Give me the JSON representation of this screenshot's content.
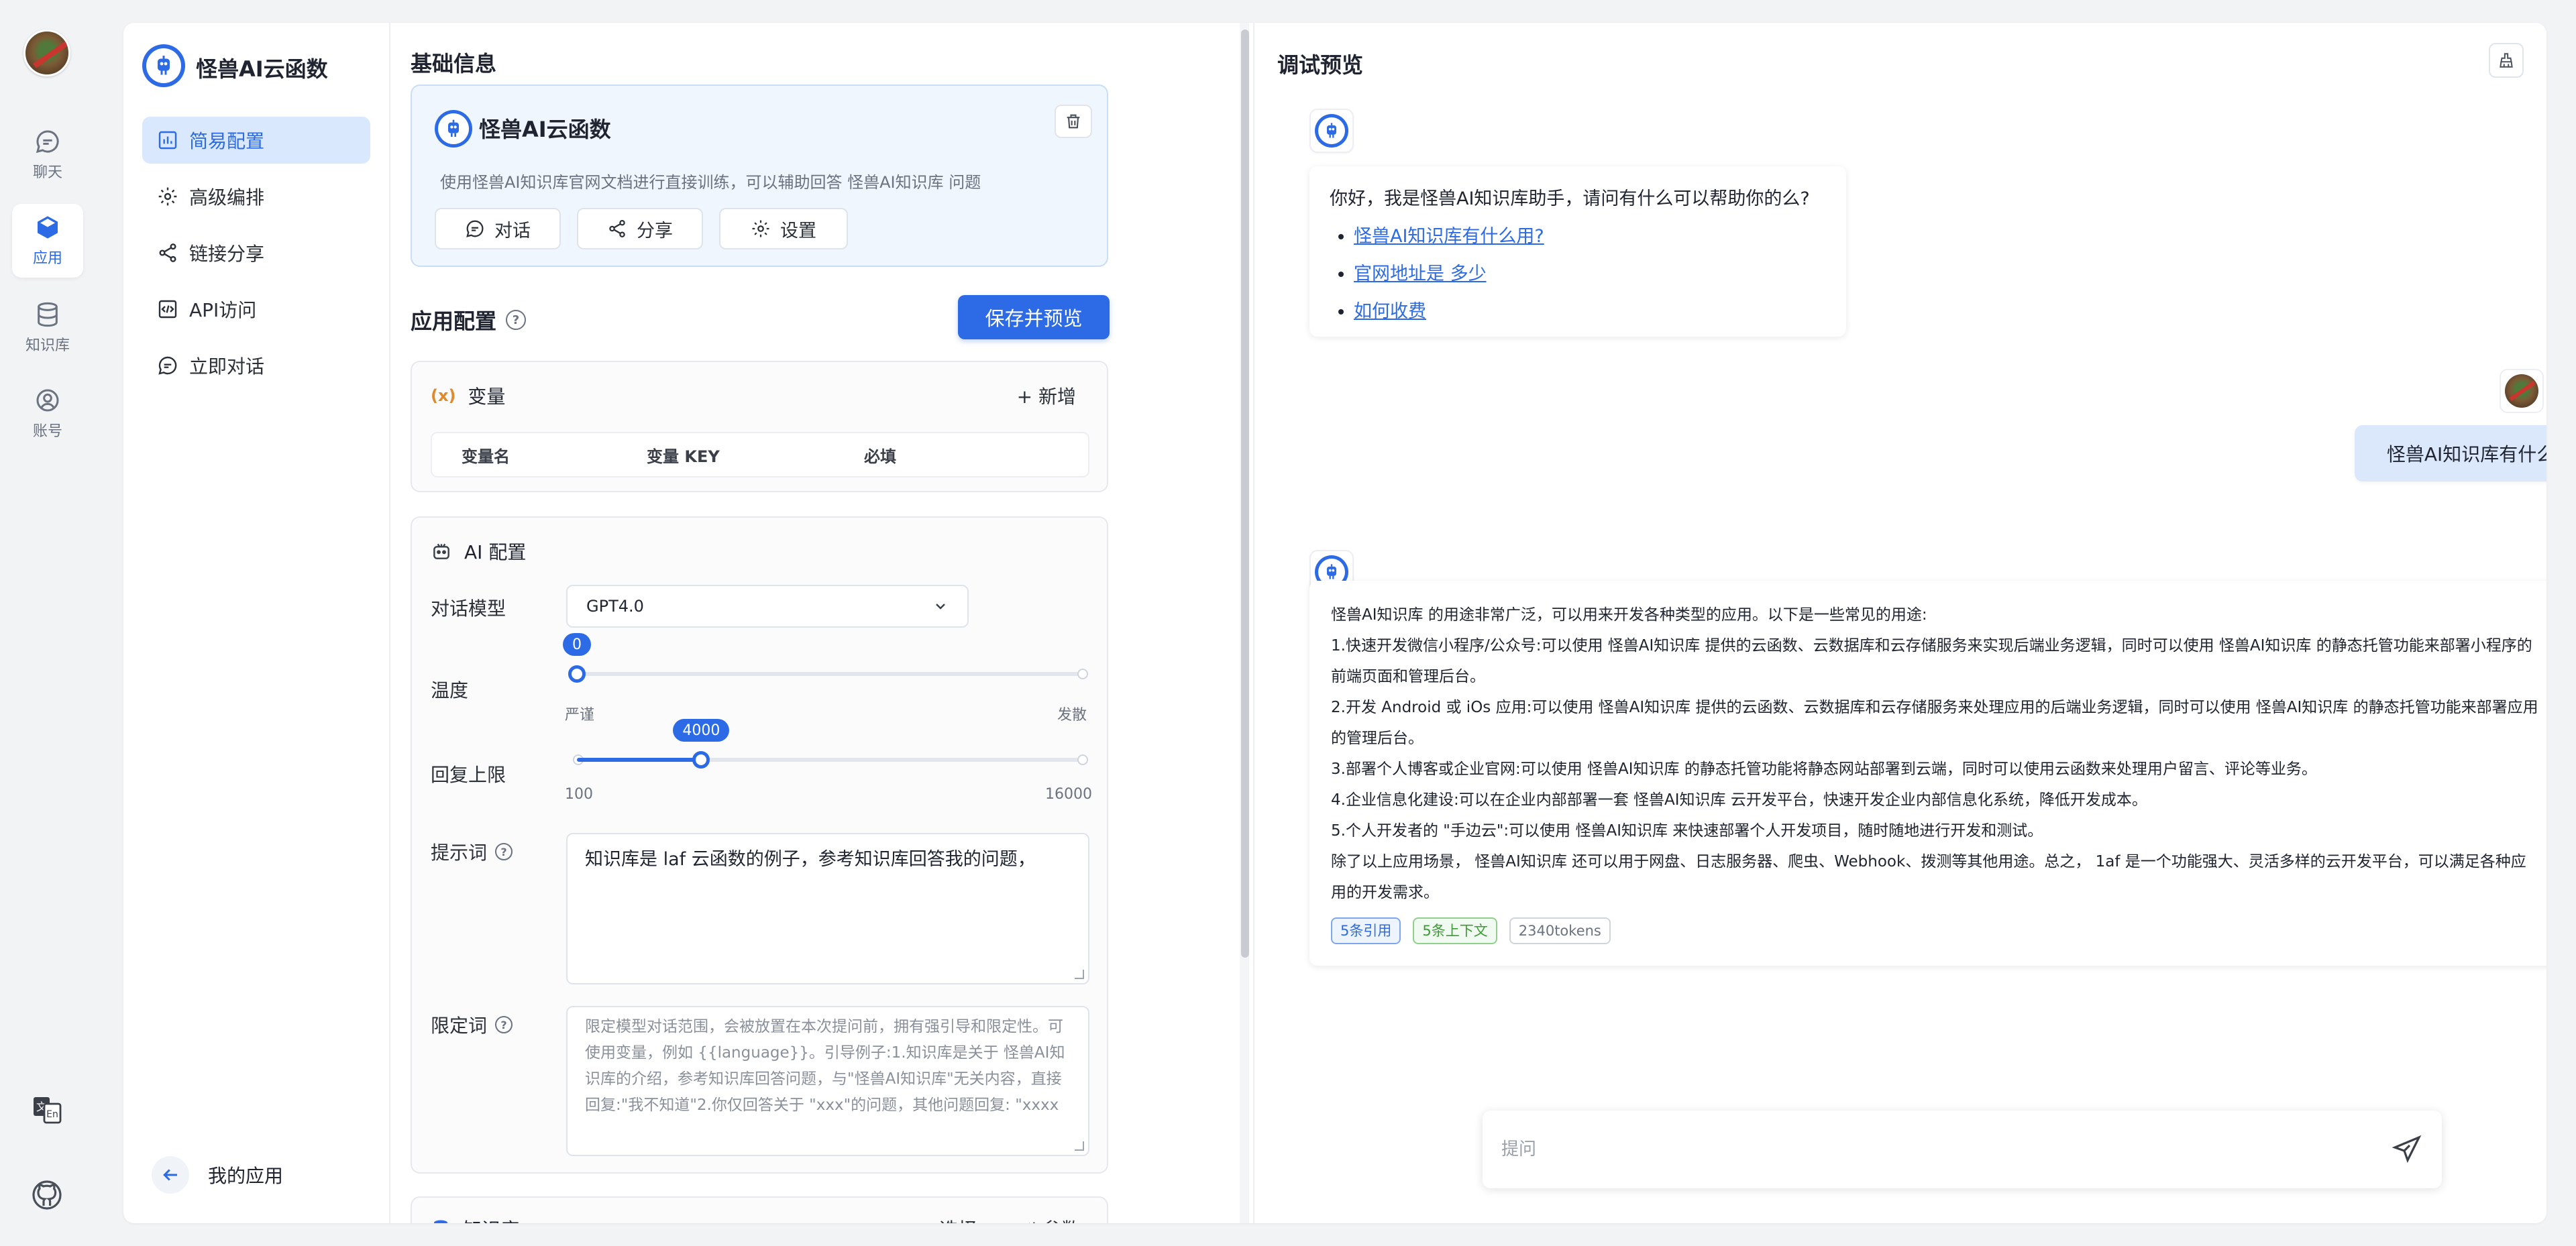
{
  "rail": {
    "items": [
      {
        "label": "聊天",
        "icon": "chat-icon"
      },
      {
        "label": "应用",
        "icon": "cube-icon",
        "active": true
      },
      {
        "label": "知识库",
        "icon": "database-icon"
      },
      {
        "label": "账号",
        "icon": "user-icon"
      }
    ]
  },
  "nav": {
    "title": "怪兽AI云函数",
    "items": [
      {
        "label": "简易配置",
        "icon": "chart-icon",
        "active": true
      },
      {
        "label": "高级编排",
        "icon": "gear-icon"
      },
      {
        "label": "链接分享",
        "icon": "share-icon"
      },
      {
        "label": "API访问",
        "icon": "code-icon"
      },
      {
        "label": "立即对话",
        "icon": "chat-icon"
      }
    ],
    "back_label": "我的应用"
  },
  "config": {
    "basic_title": "基础信息",
    "app_name": "怪兽AI云函数",
    "app_desc": "使用怪兽AI知识库官网文档进行直接训练，可以辅助回答 怪兽AI知识库 问题",
    "buttons": {
      "chat": "对话",
      "share": "分享",
      "settings": "设置"
    },
    "app_config_title": "应用配置",
    "save_label": "保存并预览",
    "variables": {
      "title": "变量",
      "add_label": "+ 新增",
      "columns": [
        "变量名",
        "变量 KEY",
        "必填"
      ]
    },
    "ai": {
      "title": "AI 配置",
      "model_label": "对话模型",
      "model_value": "GPT4.0",
      "temperature_label": "温度",
      "temperature_value": "0",
      "temperature_fraction": 0,
      "temperature_min": "严谨",
      "temperature_max": "发散",
      "max_tokens_label": "回复上限",
      "max_tokens_value": "4000",
      "max_tokens_min": "100",
      "max_tokens_max": "16000",
      "prompt_label": "提示词",
      "prompt_value": "知识库是 laf 云函数的例子，参考知识库回答我的问题，",
      "limit_label": "限定词",
      "limit_placeholder": "限定模型对话范围，会被放置在本次提问前，拥有强引导和限定性。可使用变量，例如 {{language}}。引导例子:1.知识库是关于 怪兽AI知识库的介绍，参考知识库回答问题，与\"怪兽AI知识库\"无关内容，直接回复:\"我不知道\"2.你仅回答关于 \"xxx\"的问题，其他问题回复: \"xxxx"
    },
    "kb": {
      "title": "知识库",
      "select_label": "+ 选择",
      "param_label": "参数"
    }
  },
  "preview": {
    "title": "调试预览",
    "greeting": "你好，我是怪兽AI知识库助手，请问有什么可以帮助你的么?",
    "greeting_links": [
      "怪兽AI知识库有什么用?",
      "官网地址是 多少",
      "如何收费"
    ],
    "user_message": "怪兽AI知识库有什么用?",
    "answer_lines": [
      "怪兽AI知识库 的用途非常广泛，可以用来开发各种类型的应用。以下是一些常见的用途:",
      "1.快速开发微信小程序/公众号:可以使用 怪兽AI知识库 提供的云函数、云数据库和云存储服务来实现后端业务逻辑，同时可以使用 怪兽AI知识库 的静态托管功能来部署小程序的前端页面和管理后台。",
      "2.开发 Android 或 iOs 应用:可以使用 怪兽AI知识库 提供的云函数、云数据库和云存储服务来处理应用的后端业务逻辑，同时可以使用 怪兽AI知识库 的静态托管功能来部署应用的管理后台。",
      "3.部署个人博客或企业官网:可以使用 怪兽AI知识库 的静态托管功能将静态网站部署到云端，同时可以使用云函数来处理用户留言、评论等业务。",
      "4.企业信息化建设:可以在企业内部部署一套 怪兽AI知识库 云开发平台，快速开发企业内部信息化系统，降低开发成本。",
      "5.个人开发者的 \"手边云\":可以使用 怪兽AI知识库 来快速部署个人开发项目，随时随地进行开发和测试。",
      "除了以上应用场景， 怪兽AI知识库 还可以用于网盘、日志服务器、爬虫、Webhook、拨测等其他用途。总之， 1af 是一个功能强大、灵活多样的云开发平台，可以满足各种应用的开发需求。"
    ],
    "tags": [
      "5条引用",
      "5条上下文",
      "2340tokens"
    ],
    "input_placeholder": "提问"
  },
  "colors": {
    "accent": "#2c6be5",
    "accent_light": "#d9e8fc",
    "user_bubble": "#dbe8fc"
  }
}
